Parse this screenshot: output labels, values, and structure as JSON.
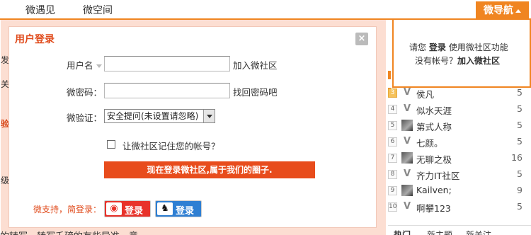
{
  "colors": {
    "accent": "#f08521",
    "brand_red": "#e84c1c",
    "weibo": "#e8322a",
    "qq": "#2e7fd3"
  },
  "topnav": {
    "items": [
      "微遇见",
      "微空间"
    ],
    "guide_label": "微导航"
  },
  "guide_popup": {
    "line1_prefix": "请您",
    "line1_login": "登录",
    "line1_suffix": "使用微社区功能",
    "line2_prefix": "没有帐号？",
    "line2_join": "加入微社区"
  },
  "background": {
    "frag1": "发",
    "frag2": "关",
    "frag3": "验",
    "frag4": "级",
    "bottom_line": "的转写，转写千磅的有些导准。意"
  },
  "modal": {
    "title": "用户登录",
    "close_icon": "×",
    "username_label": "用户名",
    "username_value": "",
    "join_link": "加入微社区",
    "password_label": "微密码：",
    "password_value": "",
    "forgot_link": "找回密码吧",
    "verify_label": "微验证：",
    "verify_selected": "安全提问(未设置请忽略)",
    "remember_label": "让微社区记住您的帐号？",
    "login_button": "现在登录微社区,属于我们的圈子.",
    "support_label": "微支持，简登录：",
    "weibo_button": "登录",
    "qq_button": "登录"
  },
  "ranking": [
    {
      "rank": "3",
      "avatar": "V",
      "name": "侯凡",
      "score": "5"
    },
    {
      "rank": "4",
      "avatar": "V",
      "name": "似水天涯",
      "score": "5"
    },
    {
      "rank": "5",
      "avatar": "img",
      "name": "第式人称",
      "score": "5"
    },
    {
      "rank": "6",
      "avatar": "V",
      "name": "七颜。",
      "score": "5"
    },
    {
      "rank": "7",
      "avatar": "img",
      "name": "无聊之极",
      "score": "16"
    },
    {
      "rank": "8",
      "avatar": "V",
      "name": "齐力IT社区",
      "score": "5"
    },
    {
      "rank": "9",
      "avatar": "img",
      "name": "Kailven;",
      "score": "9"
    },
    {
      "rank": "10",
      "avatar": "V",
      "name": "啊攀123",
      "score": "5"
    }
  ],
  "bottom_tabs": [
    "热门",
    "新主题",
    "新关注"
  ]
}
